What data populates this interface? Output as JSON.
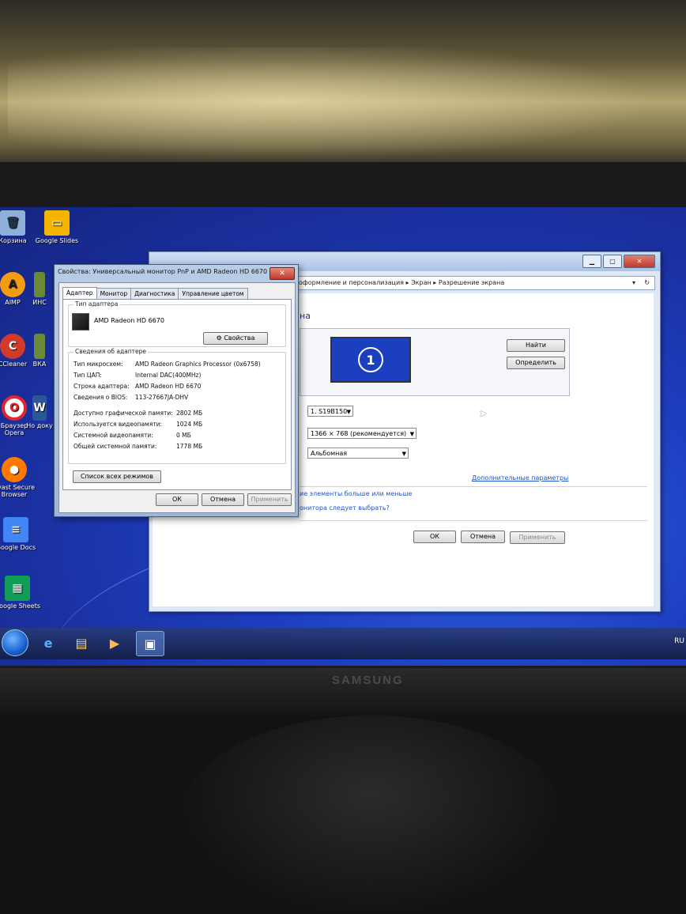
{
  "desktop": {
    "icons": [
      {
        "label": "Корзина",
        "icon": "recycle-bin-icon"
      },
      {
        "label": "Google Slides",
        "icon": "google-slides-icon"
      },
      {
        "label": "AIMP",
        "icon": "aimp-icon"
      },
      {
        "label": "ИНС",
        "icon": "shortcut-icon"
      },
      {
        "label": "CCleaner",
        "icon": "ccleaner-icon"
      },
      {
        "label": "ВКА",
        "icon": "shortcut-icon"
      },
      {
        "label": "Браузер Opera",
        "icon": "opera-icon"
      },
      {
        "label": "Но доку",
        "icon": "word-icon"
      },
      {
        "label": "Avast Secure Browser",
        "icon": "avast-browser-icon"
      },
      {
        "label": "Google Docs",
        "icon": "google-docs-icon"
      },
      {
        "label": "Google Sheets",
        "icon": "google-sheets-icon"
      }
    ]
  },
  "taskbar": {
    "tray_lang": "RU",
    "items": [
      "start-orb-icon",
      "internet-explorer-icon",
      "explorer-folder-icon",
      "media-player-icon",
      "display-settings-icon"
    ]
  },
  "resolution_window": {
    "breadcrumb": "оформление и персонализация ▸ Экран ▸ Разрешение экрана",
    "heading_fragment": "на",
    "monitor_number": "1",
    "find_button": "Найти",
    "detect_button": "Определить",
    "display_value": "1. S19B150",
    "resolution_value": "1366 × 768 (рекомендуется)",
    "orientation_value": "Альбомная",
    "advanced_link": "Дополнительные параметры",
    "link1": "ие элементы больше или меньше",
    "link2": "онитора следует выбрать?",
    "ok": "ОК",
    "cancel": "Отмена",
    "apply": "Применить"
  },
  "properties_dialog": {
    "title": "Свойства: Универсальный монитор PnP и AMD Radeon HD 6670",
    "tabs": [
      "Адаптер",
      "Монитор",
      "Диагностика",
      "Управление цветом"
    ],
    "adapter_type_group": "Тип адаптера",
    "adapter_name": "AMD Radeon HD 6670",
    "properties_button": "Свойства",
    "info_group": "Сведения об адаптере",
    "info": [
      {
        "label": "Тип микросхем:",
        "value": "AMD Radeon Graphics Processor (0x6758)"
      },
      {
        "label": "Тип ЦАП:",
        "value": "Internal DAC(400MHz)"
      },
      {
        "label": "Строка адаптера:",
        "value": "AMD Radeon HD 6670"
      },
      {
        "label": "Сведения о BIOS:",
        "value": "113-27667JA-DHV"
      }
    ],
    "memory": [
      {
        "label": "Доступно графической памяти:",
        "value": "2802 МБ"
      },
      {
        "label": "Используется видеопамяти:",
        "value": "1024 МБ"
      },
      {
        "label": "Системной видеопамяти:",
        "value": "0 МБ"
      },
      {
        "label": "Общей системной памяти:",
        "value": "1778 МБ"
      }
    ],
    "list_modes_button": "Список всех режимов",
    "ok": "ОК",
    "cancel": "Отмена",
    "apply": "Применить"
  },
  "monitor_brand": "SAMSUNG"
}
